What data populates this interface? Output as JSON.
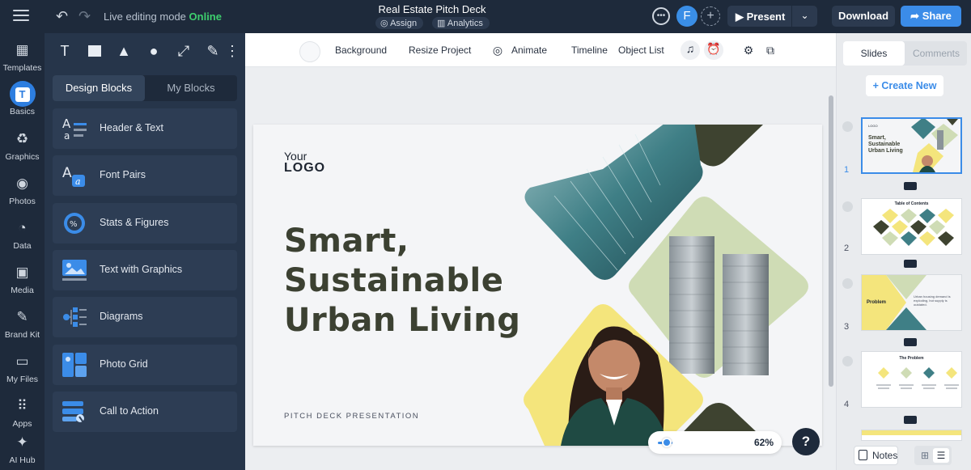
{
  "header": {
    "mode_label": "Live editing mode",
    "mode_status": "Online",
    "project_title": "Real Estate Pitch Deck",
    "assign_label": "Assign",
    "analytics_label": "Analytics",
    "avatar_initial": "F",
    "present_label": "Present",
    "download_label": "Download",
    "share_label": "Share"
  },
  "rail": {
    "items": [
      {
        "label": "Templates",
        "icon": "templates-icon"
      },
      {
        "label": "Basics",
        "icon": "basics-icon",
        "active": true
      },
      {
        "label": "Graphics",
        "icon": "graphics-icon"
      },
      {
        "label": "Photos",
        "icon": "photos-icon"
      },
      {
        "label": "Data",
        "icon": "data-icon"
      },
      {
        "label": "Media",
        "icon": "media-icon"
      },
      {
        "label": "Brand Kit",
        "icon": "brand-kit-icon"
      },
      {
        "label": "My Files",
        "icon": "folder-icon"
      },
      {
        "label": "Apps",
        "icon": "apps-icon"
      },
      {
        "label": "AI Hub",
        "icon": "sparkle-icon"
      }
    ]
  },
  "panel": {
    "tools": [
      "text-tool-icon",
      "rectangle-tool-icon",
      "triangle-tool-icon",
      "circle-tool-icon",
      "line-tool-icon",
      "pen-tool-icon",
      "more-icon"
    ],
    "tabs": [
      {
        "label": "Design Blocks"
      },
      {
        "label": "My Blocks"
      }
    ],
    "blocks": [
      {
        "label": "Header & Text"
      },
      {
        "label": "Font Pairs"
      },
      {
        "label": "Stats & Figures"
      },
      {
        "label": "Text with Graphics"
      },
      {
        "label": "Diagrams"
      },
      {
        "label": "Photo Grid"
      },
      {
        "label": "Call to Action"
      }
    ]
  },
  "canvas_toolbar": {
    "background_label": "Background",
    "resize_label": "Resize Project",
    "animate_label": "Animate",
    "timeline_label": "Timeline",
    "object_list_label": "Object List"
  },
  "slide": {
    "logo_line1": "Your",
    "logo_line2": "LOGO",
    "headline_lines": [
      "Smart,",
      "Sustainable",
      "Urban Living"
    ],
    "subtitle": "PITCH DECK PRESENTATION",
    "colors": {
      "dark_olive": "#3e4330",
      "teal": "#5d9590",
      "sage": "#cfdcb5",
      "yellow": "#f4e57c",
      "headline": "#3c4132"
    }
  },
  "zoom": {
    "value": "62%",
    "level_fraction": 0.15
  },
  "help_label": "?",
  "right_panel": {
    "tabs": [
      {
        "label": "Slides"
      },
      {
        "label": "Comments"
      }
    ],
    "create_new_label": "+ Create New",
    "slides": [
      {
        "num": "1",
        "title_lines": [
          "Smart,",
          "Sustainable",
          "Urban Living"
        ]
      },
      {
        "num": "2",
        "title": "Table of Contents"
      },
      {
        "num": "3",
        "title": "Problem",
        "body": "Urban housing demand is exploding, but supply is outdated."
      },
      {
        "num": "4",
        "title": "The Problem"
      }
    ],
    "notes_label": "Notes"
  }
}
